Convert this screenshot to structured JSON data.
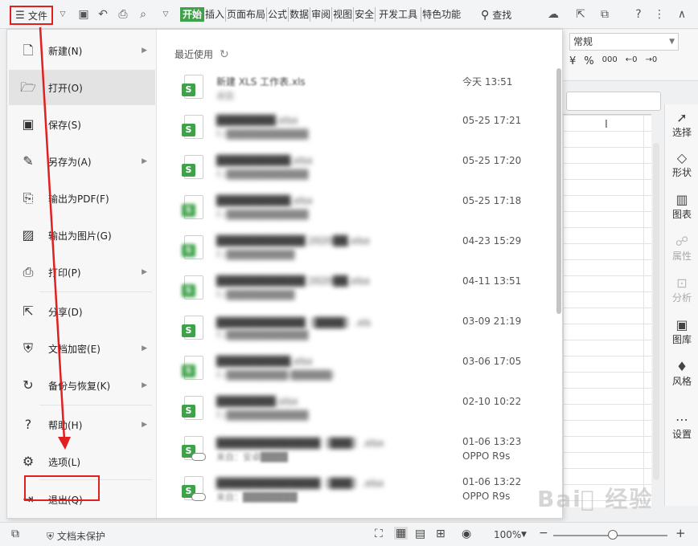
{
  "toolbar": {
    "file_label": "文件",
    "tabs": [
      "开始",
      "插入",
      "页面布局",
      "公式",
      "数据",
      "审阅",
      "视图",
      "安全",
      "开发工具",
      "特色功能"
    ],
    "search_label": "查找",
    "help_label": "?"
  },
  "ribbon": {
    "number_format": "常规",
    "percent_label": "%",
    "thousand_label": "000"
  },
  "side_panel": {
    "items": [
      "选择",
      "形状",
      "图表",
      "属性",
      "分析",
      "图库",
      "风格",
      "设置"
    ]
  },
  "file_menu": {
    "items": [
      {
        "label": "新建(N)",
        "icon": "new-file-icon",
        "has_arrow": true
      },
      {
        "label": "打开(O)",
        "icon": "folder-open-icon",
        "has_arrow": false
      },
      {
        "label": "保存(S)",
        "icon": "save-icon",
        "has_arrow": false
      },
      {
        "label": "另存为(A)",
        "icon": "save-as-icon",
        "has_arrow": true
      },
      {
        "label": "输出为PDF(F)",
        "icon": "pdf-icon",
        "has_arrow": false
      },
      {
        "label": "输出为图片(G)",
        "icon": "image-icon",
        "has_arrow": false
      },
      {
        "label": "打印(P)",
        "icon": "print-icon",
        "has_arrow": true
      },
      {
        "label": "分享(D)",
        "icon": "share-icon",
        "has_arrow": false
      },
      {
        "label": "文档加密(E)",
        "icon": "encrypt-icon",
        "has_arrow": true
      },
      {
        "label": "备份与恢复(K)",
        "icon": "backup-icon",
        "has_arrow": true
      },
      {
        "label": "帮助(H)",
        "icon": "help-icon",
        "has_arrow": true
      },
      {
        "label": "选项(L)",
        "icon": "gear-icon",
        "has_arrow": false
      },
      {
        "label": "退出(Q)",
        "icon": "exit-icon",
        "has_arrow": false
      }
    ],
    "active_item": "打开(O)"
  },
  "recent": {
    "title": "最近使用",
    "files": [
      {
        "name": "新建 XLS 工作表.xls",
        "path": "桌面",
        "date": "今天 13:51",
        "device": ""
      },
      {
        "name": "████████.xlsx",
        "path": "F:/████████████",
        "date": "05-25 17:21",
        "device": ""
      },
      {
        "name": "██████████.xlsx",
        "path": "F:/████████████",
        "date": "05-25 17:20",
        "device": ""
      },
      {
        "name": "██████████.xlsx",
        "path": "F:/████████████",
        "date": "05-25 17:18",
        "device": ""
      },
      {
        "name": "████████████ 2020██.xlsx",
        "path": "F:/██████████",
        "date": "04-23 15:29",
        "device": ""
      },
      {
        "name": "████████████ 2020██.xlsx",
        "path": "F:/██████████",
        "date": "04-11 13:51",
        "device": ""
      },
      {
        "name": "████████████【████】.xls",
        "path": "F:/████████████",
        "date": "03-09 21:19",
        "device": ""
      },
      {
        "name": "██████████.xlsx",
        "path": "F:/█████████/██████/",
        "date": "03-06 17:05",
        "device": ""
      },
      {
        "name": "████████.xlsx",
        "path": "F:/████████████",
        "date": "02-10 10:22",
        "device": ""
      },
      {
        "name": "██████████████【███】.xlsx",
        "path": "来自：安卓████",
        "date": "01-06 13:23",
        "device": "OPPO R9s"
      },
      {
        "name": "██████████████【███】.xlsx",
        "path": "来自：████████",
        "date": "01-06 13:22",
        "device": "OPPO R9s"
      }
    ]
  },
  "statusbar": {
    "protect_label": "文档未保护",
    "zoom_label": "100%"
  },
  "colors": {
    "accent_green": "#3fa24a",
    "highlight_red": "#e02020"
  }
}
